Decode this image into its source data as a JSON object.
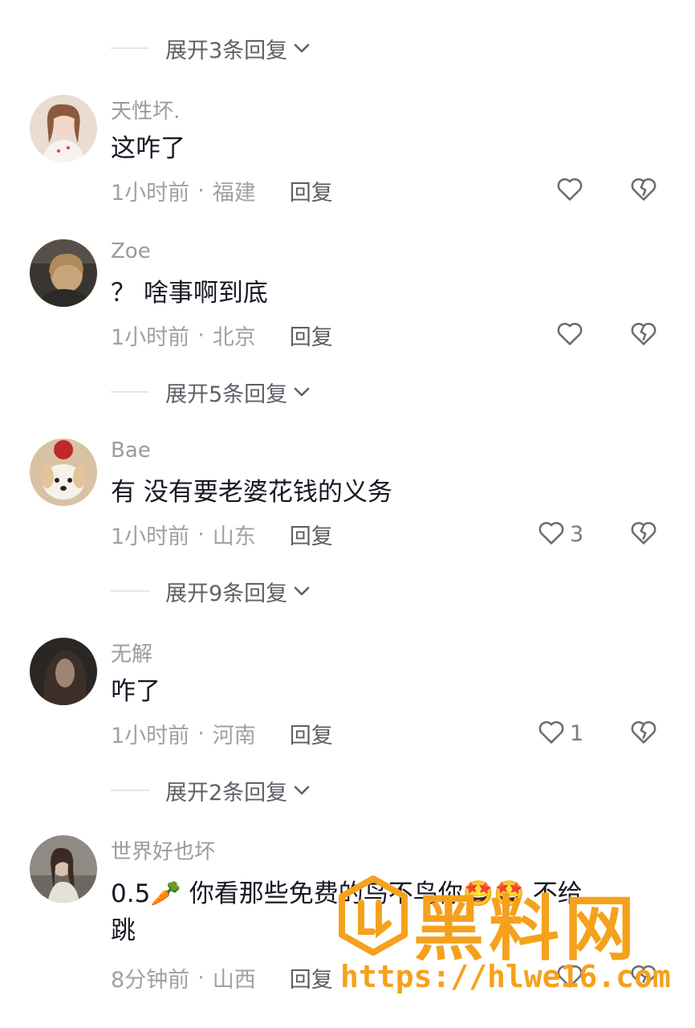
{
  "expand_labels": [
    "展开3条回复",
    "展开5条回复",
    "展开9条回复",
    "展开2条回复"
  ],
  "comments": [
    {
      "username": "天性坏.",
      "text": "这咋了",
      "time": "1小时前",
      "separator": "·",
      "location": "福建",
      "reply": "回复",
      "likes": ""
    },
    {
      "username": "Zoe",
      "text": "？ 啥事啊到底",
      "time": "1小时前",
      "separator": "·",
      "location": "北京",
      "reply": "回复",
      "likes": ""
    },
    {
      "username": "Bae",
      "text": "有 没有要老婆花钱的义务",
      "time": "1小时前",
      "separator": "·",
      "location": "山东",
      "reply": "回复",
      "likes": "3"
    },
    {
      "username": "无解",
      "text": "咋了",
      "time": "1小时前",
      "separator": "·",
      "location": "河南",
      "reply": "回复",
      "likes": "1"
    },
    {
      "username": "世界好也坏",
      "text_line1": "0.5🥕 你看那些免费的鸟不鸟你🤩🤩 不给",
      "text_line2": "跳",
      "time": "8分钟前",
      "separator": "·",
      "location": "山西",
      "reply": "回复",
      "likes": ""
    }
  ],
  "watermark": {
    "brand": "黑料网",
    "url": "https://hlwe16.com"
  },
  "colors": {
    "meta": "#a0a0a6",
    "text": "#161823",
    "watermark": "#f5a11c"
  }
}
